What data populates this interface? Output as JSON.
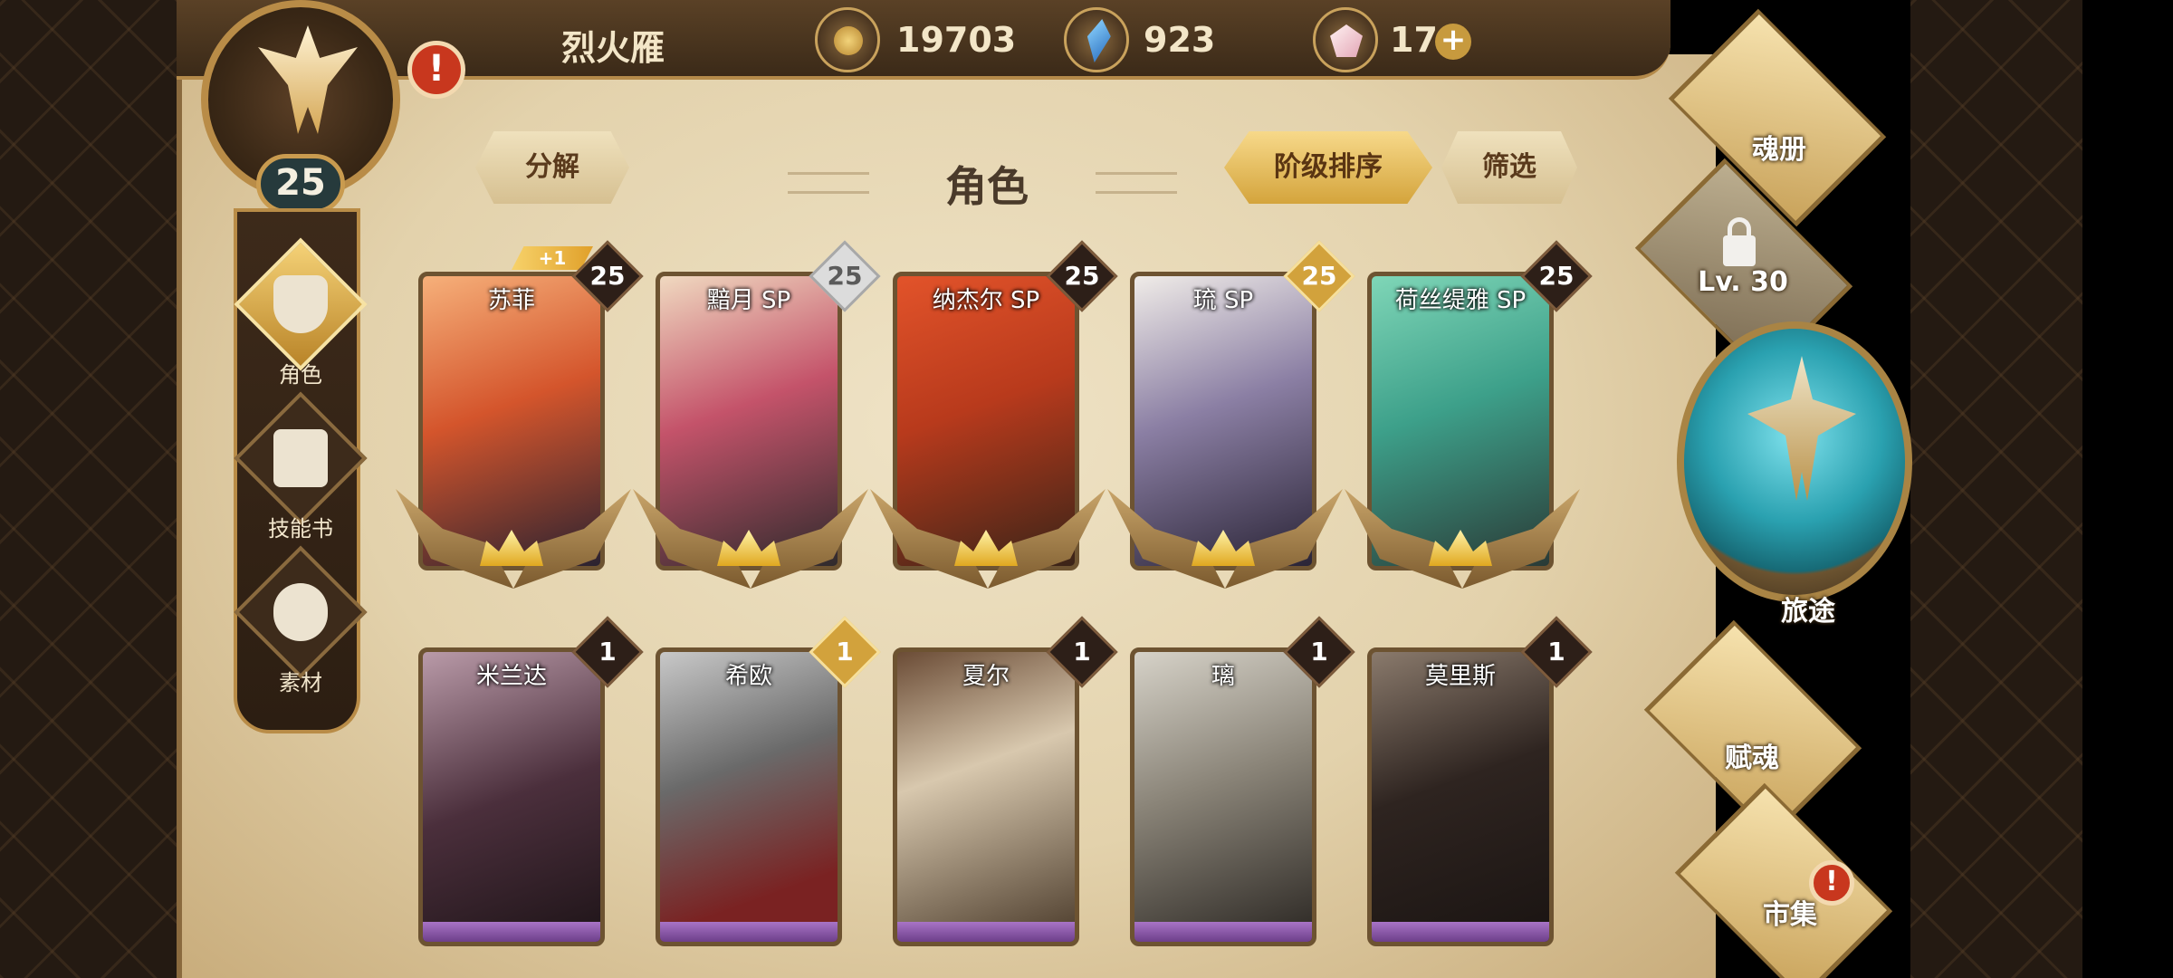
{
  "header": {
    "player_name": "烈火雁",
    "player_level": "25",
    "resources": [
      {
        "icon": "coin-icon",
        "value": "19703"
      },
      {
        "icon": "gem-icon",
        "value": "923"
      },
      {
        "icon": "crystal-icon",
        "value": "17"
      }
    ],
    "plus_label": "+",
    "alert_label": "!"
  },
  "left_nav": {
    "items": [
      {
        "label": "角色",
        "icon": "character-icon",
        "active": true
      },
      {
        "label": "技能书",
        "icon": "skillbook-icon",
        "active": false
      },
      {
        "label": "素材",
        "icon": "material-icon",
        "active": false
      }
    ]
  },
  "panel": {
    "title": "角色",
    "decompose_label": "分解",
    "sort_label": "阶级排序",
    "filter_label": "筛选"
  },
  "cards_row1": [
    {
      "name": "苏菲",
      "rank": "25",
      "plus": "+1",
      "badge": "dark"
    },
    {
      "name": "黯月 SP",
      "rank": "25",
      "badge": "silver"
    },
    {
      "name": "纳杰尔 SP",
      "rank": "25",
      "badge": "dark"
    },
    {
      "name": "琉 SP",
      "rank": "25",
      "badge": "gold"
    },
    {
      "name": "荷丝缇雅 SP",
      "rank": "25",
      "badge": "dark"
    }
  ],
  "cards_row2": [
    {
      "name": "米兰达",
      "rank": "1",
      "badge": "dark"
    },
    {
      "name": "希欧",
      "rank": "1",
      "badge": "gold"
    },
    {
      "name": "夏尔",
      "rank": "1",
      "badge": "dark"
    },
    {
      "name": "璃",
      "rank": "1",
      "badge": "dark"
    },
    {
      "name": "莫里斯",
      "rank": "1",
      "badge": "dark"
    }
  ],
  "right_nav": {
    "soul_book": "魂册",
    "locked_level": "Lv. 30",
    "journey": "旅途",
    "endow_soul": "赋魂",
    "market": "市集"
  },
  "colors": {
    "parchment": "#e6d6b0",
    "gold": "#d4a43c",
    "dark_brown": "#2d1f18",
    "teal": "#2aa1b0"
  }
}
